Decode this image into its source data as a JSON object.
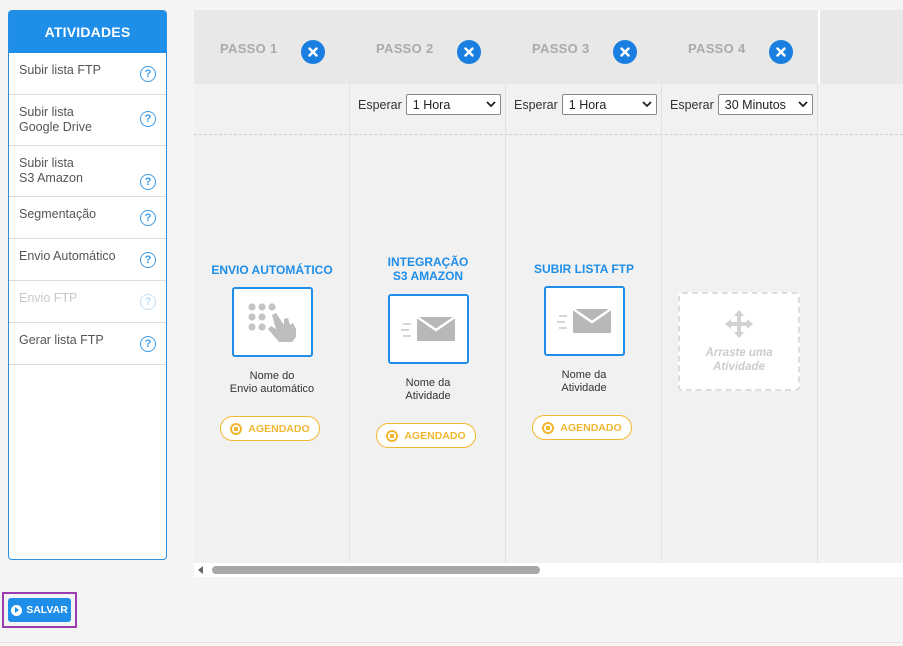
{
  "sidebar": {
    "title": "ATIVIDADES",
    "items": [
      {
        "label_lines": [
          "Subir lista FTP"
        ],
        "disabled": false
      },
      {
        "label_lines": [
          "Subir lista",
          "Google Drive"
        ],
        "disabled": false
      },
      {
        "label_lines": [
          "Subir lista",
          "S3 Amazon"
        ],
        "disabled": false
      },
      {
        "label_lines": [
          "Segmentação"
        ],
        "disabled": false
      },
      {
        "label_lines": [
          "Envio Automático"
        ],
        "disabled": false
      },
      {
        "label_lines": [
          "Envio FTP"
        ],
        "disabled": true
      },
      {
        "label_lines": [
          "Gerar lista FTP"
        ],
        "disabled": false
      }
    ],
    "help_glyph": "?"
  },
  "steps": [
    {
      "title": "PASSO 1",
      "activity": {
        "title_lines": [
          "ENVIO AUTOMÁTICO"
        ],
        "icon": "hand-keypad-icon",
        "name_lines": [
          "Nome do",
          "Envio automático"
        ]
      },
      "status": "AGENDADO"
    },
    {
      "title": "PASSO 2",
      "wait": {
        "label": "Esperar",
        "value": "1 Hora"
      },
      "activity": {
        "title_lines": [
          "INTEGRAÇÃO",
          "S3 AMAZON"
        ],
        "icon": "envelope-fast-icon",
        "name_lines": [
          "Nome da",
          "Atividade"
        ]
      },
      "status": "AGENDADO"
    },
    {
      "title": "PASSO 3",
      "wait": {
        "label": "Esperar",
        "value": "1 Hora"
      },
      "activity": {
        "title_lines": [
          "SUBIR LISTA FTP"
        ],
        "icon": "envelope-fast-icon",
        "name_lines": [
          "Nome da",
          "Atividade"
        ]
      },
      "status": "AGENDADO"
    },
    {
      "title": "PASSO 4",
      "wait": {
        "label": "Esperar",
        "value": "30 Minutos"
      },
      "drop_zone": {
        "text_lines": [
          "Arraste uma",
          "Atividade"
        ]
      }
    }
  ],
  "save_label": "SALVAR",
  "colors": {
    "primary": "#1e8ee9",
    "status": "#f2b731",
    "highlight": "#9b3db0"
  }
}
